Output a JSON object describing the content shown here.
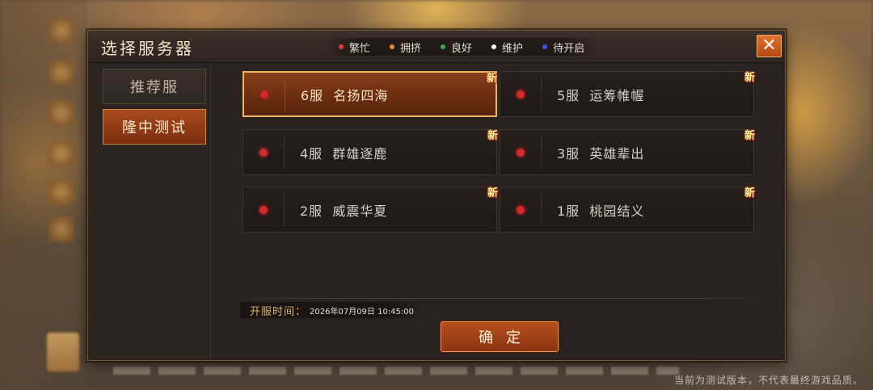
{
  "dialog": {
    "title": "选择服务器",
    "close_label": "✕"
  },
  "legend": [
    {
      "label": "繁忙",
      "color": "#e03a3a"
    },
    {
      "label": "拥挤",
      "color": "#f08a2a"
    },
    {
      "label": "良好",
      "color": "#3aa83a"
    },
    {
      "label": "维护",
      "color": "#ffffff"
    },
    {
      "label": "待开启",
      "color": "#3a5ae0"
    }
  ],
  "sidebar": {
    "tabs": [
      {
        "label": "推荐服",
        "active": false
      },
      {
        "label": "隆中测试",
        "active": true
      }
    ]
  },
  "servers": [
    {
      "name": "6服  名扬四海",
      "badge": "新",
      "status": "busy",
      "selected": true
    },
    {
      "name": "5服  运筹帷幄",
      "badge": "新",
      "status": "busy",
      "selected": false
    },
    {
      "name": "4服  群雄逐鹿",
      "badge": "新",
      "status": "busy",
      "selected": false
    },
    {
      "name": "3服  英雄辈出",
      "badge": "新",
      "status": "busy",
      "selected": false
    },
    {
      "name": "2服  威震华夏",
      "badge": "新",
      "status": "busy",
      "selected": false
    },
    {
      "name": "1服  桃园结义",
      "badge": "新",
      "status": "busy",
      "selected": false
    }
  ],
  "open_time": {
    "label": "开服时间：",
    "value": "2026年07月09日  10:45:00"
  },
  "confirm_label": "确定",
  "disclaimer": "当前为测试版本，不代表最终游戏品质。",
  "colors": {
    "status_busy": "#d02a2a",
    "accent": "#e8b862",
    "active_tab": "#a84a1c"
  }
}
